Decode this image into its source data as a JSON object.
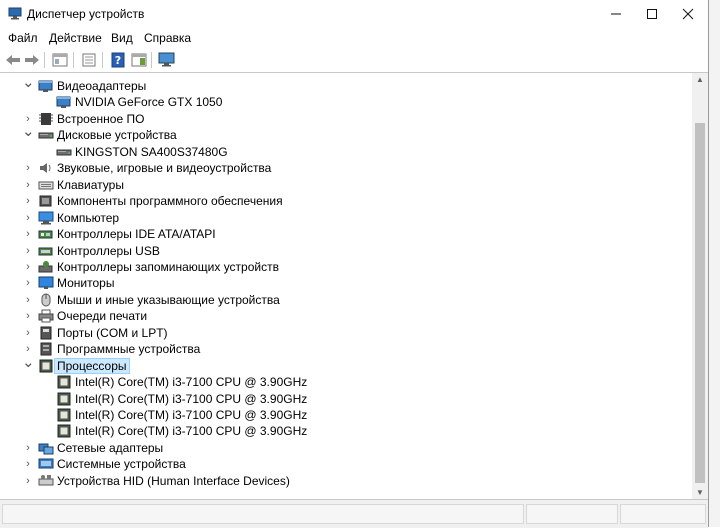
{
  "window": {
    "title": "Диспетчер устройств"
  },
  "menu": [
    "Файл",
    "Действие",
    "Вид",
    "Справка"
  ],
  "colors": {
    "selection": "#cce8ff",
    "titlebar_bg": "#ffffff",
    "statusbar_bg": "#f0f0f0"
  },
  "tree": {
    "items": [
      {
        "label": "Видеоадаптеры",
        "level": 0,
        "expanded": true,
        "icon": "display-adapter-icon"
      },
      {
        "label": "NVIDIA GeForce GTX 1050",
        "level": 1,
        "icon": "display-adapter-icon"
      },
      {
        "label": "Встроенное ПО",
        "level": 0,
        "expanded": false,
        "icon": "firmware-icon"
      },
      {
        "label": "Дисковые устройства",
        "level": 0,
        "expanded": true,
        "icon": "disk-drive-icon"
      },
      {
        "label": "KINGSTON SA400S37480G",
        "level": 1,
        "icon": "disk-drive-icon"
      },
      {
        "label": "Звуковые, игровые и видеоустройства",
        "level": 0,
        "expanded": false,
        "icon": "speaker-icon"
      },
      {
        "label": "Клавиатуры",
        "level": 0,
        "expanded": false,
        "icon": "keyboard-icon"
      },
      {
        "label": "Компоненты программного обеспечения",
        "level": 0,
        "expanded": false,
        "icon": "software-component-icon"
      },
      {
        "label": "Компьютер",
        "level": 0,
        "expanded": false,
        "icon": "computer-icon"
      },
      {
        "label": "Контроллеры IDE ATA/ATAPI",
        "level": 0,
        "expanded": false,
        "icon": "ide-controller-icon"
      },
      {
        "label": "Контроллеры USB",
        "level": 0,
        "expanded": false,
        "icon": "usb-controller-icon"
      },
      {
        "label": "Контроллеры запоминающих устройств",
        "level": 0,
        "expanded": false,
        "icon": "storage-controller-icon"
      },
      {
        "label": "Мониторы",
        "level": 0,
        "expanded": false,
        "icon": "monitor-icon"
      },
      {
        "label": "Мыши и иные указывающие устройства",
        "level": 0,
        "expanded": false,
        "icon": "mouse-icon"
      },
      {
        "label": "Очереди печати",
        "level": 0,
        "expanded": false,
        "icon": "printer-icon"
      },
      {
        "label": "Порты (COM и LPT)",
        "level": 0,
        "expanded": false,
        "icon": "port-icon"
      },
      {
        "label": "Программные устройства",
        "level": 0,
        "expanded": false,
        "icon": "software-device-icon"
      },
      {
        "label": "Процессоры",
        "level": 0,
        "expanded": true,
        "selected": true,
        "icon": "processor-icon"
      },
      {
        "label": "Intel(R) Core(TM) i3-7100 CPU @ 3.90GHz",
        "level": 1,
        "icon": "processor-icon"
      },
      {
        "label": "Intel(R) Core(TM) i3-7100 CPU @ 3.90GHz",
        "level": 1,
        "icon": "processor-icon"
      },
      {
        "label": "Intel(R) Core(TM) i3-7100 CPU @ 3.90GHz",
        "level": 1,
        "icon": "processor-icon"
      },
      {
        "label": "Intel(R) Core(TM) i3-7100 CPU @ 3.90GHz",
        "level": 1,
        "icon": "processor-icon"
      },
      {
        "label": "Сетевые адаптеры",
        "level": 0,
        "expanded": false,
        "icon": "network-adapter-icon"
      },
      {
        "label": "Системные устройства",
        "level": 0,
        "expanded": false,
        "icon": "system-device-icon"
      },
      {
        "label": "Устройства HID (Human Interface Devices)",
        "level": 0,
        "expanded": false,
        "icon": "hid-icon"
      }
    ]
  }
}
